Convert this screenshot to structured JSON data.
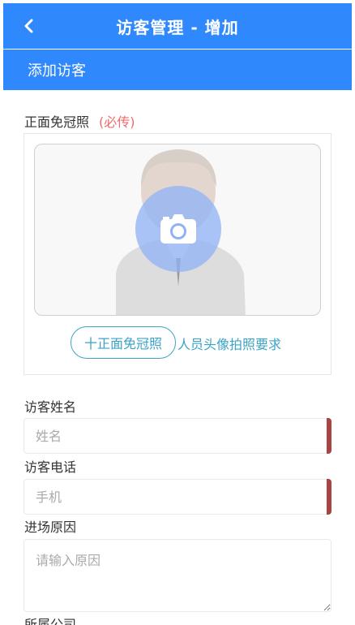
{
  "header": {
    "title": "访客管理 - 增加",
    "back_icon": "chevron-left-icon"
  },
  "subbar": {
    "label": "添加访客"
  },
  "photo": {
    "label": "正面免冠照",
    "required": "(必传)",
    "add_button": "十正面免冠照",
    "requirements_link": "人员头像拍照要求",
    "camera_icon": "camera-icon"
  },
  "fields": {
    "name": {
      "label": "访客姓名",
      "placeholder": "姓名"
    },
    "phone": {
      "label": "访客电话",
      "placeholder": "手机"
    },
    "reason": {
      "label": "进场原因",
      "placeholder": "请输入原因"
    },
    "company": {
      "label": "所属公司"
    }
  },
  "colors": {
    "primary": "#2f89fc",
    "required_flag": "#a94442",
    "link": "#3aa4c5",
    "required_text": "#ef6b6b"
  }
}
